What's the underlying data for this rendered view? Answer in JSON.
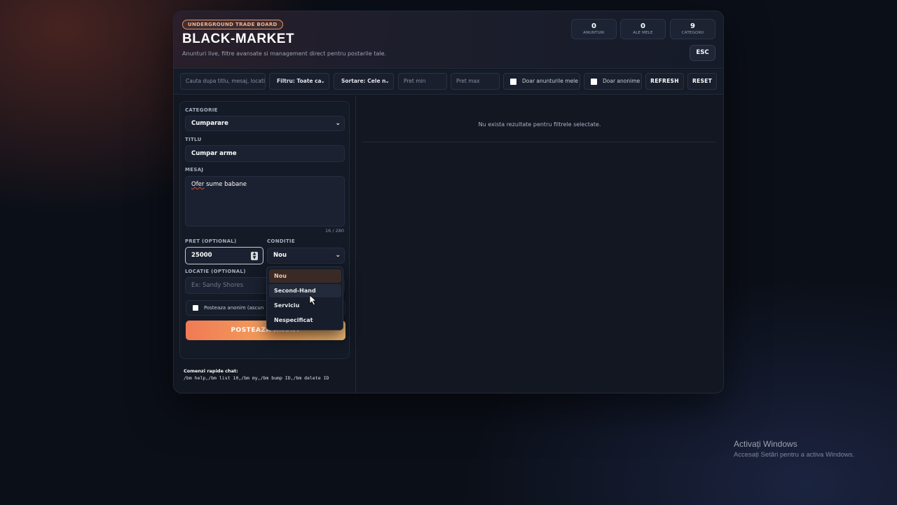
{
  "header": {
    "badge": "UNDERGROUND TRADE BOARD",
    "title": "BLACK-MARKET",
    "subtitle": "Anunturi live, filtre avansate si management direct pentru postarile tale.",
    "stats": [
      {
        "value": "0",
        "label": "ANUNTURI"
      },
      {
        "value": "0",
        "label": "ALE MELE"
      },
      {
        "value": "9",
        "label": "CATEGORII"
      }
    ],
    "esc_label": "ESC"
  },
  "toolbar": {
    "search_placeholder": "Cauta dupa titlu, mesaj, locatie",
    "filter_value": "Filtru: Toate ca",
    "sort_value": "Sortare: Cele n",
    "price_min_placeholder": "Pret min",
    "price_max_placeholder": "Pret max",
    "only_mine_label": "Doar anunturile mele",
    "only_anon_label": "Doar anonime",
    "refresh_label": "REFRESH",
    "reset_label": "RESET"
  },
  "form": {
    "category_label": "CATEGORIE",
    "category_value": "Cumparare",
    "title_label": "TITLU",
    "title_value": "Cumpar arme",
    "message_label": "MESAJ",
    "message_word": "Ofer",
    "message_rest": " sume babane",
    "counter": "16 / 280",
    "price_label": "PRET (OPTIONAL)",
    "price_value": "25000",
    "condition_label": "CONDITIE",
    "condition_value": "Nou",
    "location_label": "LOCATIE (OPTIONAL)",
    "location_placeholder": "Ex: Sandy Shores",
    "anon_label": "Posteaza anonim (ascun",
    "post_label": "POSTEAZA ANUNT"
  },
  "condition_options": [
    "Nou",
    "Second-Hand",
    "Serviciu",
    "Nespecificat"
  ],
  "commands": {
    "title": "Comenzi rapide chat:",
    "text": "/bm help,/bm list 10,/bm my,/bm bump ID,/bm delete ID"
  },
  "results": {
    "empty_message": "Nu exista rezultate pentru filtrele selectate."
  },
  "watermark": {
    "title": "Activați Windows",
    "subtitle": "Accesați Setări pentru a activa Windows."
  },
  "colors": {
    "accent": "#f3a45c",
    "background": "#0b0f18",
    "panel": "#121722"
  }
}
